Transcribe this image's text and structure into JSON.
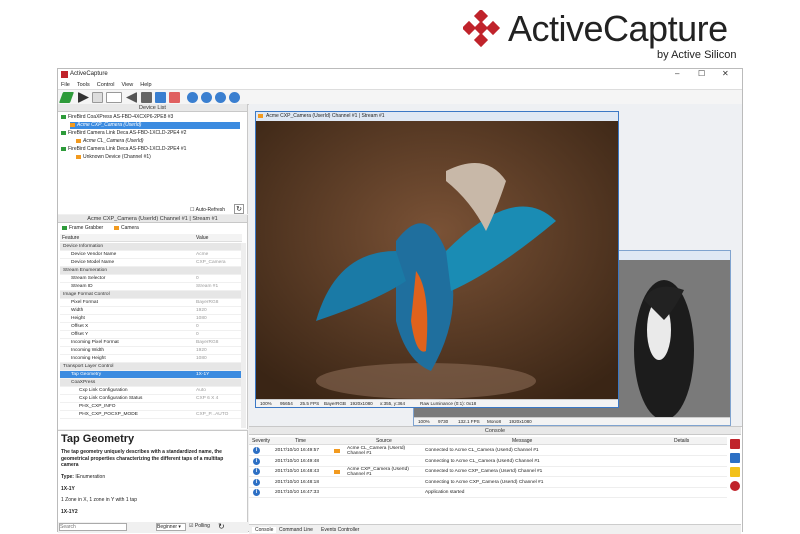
{
  "brand": {
    "name": "ActiveCapture",
    "sub": "by Active Silicon",
    "accent": "#c0232b"
  },
  "window": {
    "title": "ActiveCapture",
    "minimize": "–",
    "maximize": "☐",
    "close": "✕"
  },
  "menu": [
    "File",
    "Tools",
    "Control",
    "View",
    "Help"
  ],
  "device_list": {
    "title": "Device List",
    "items": [
      {
        "label": "FireBird CoaXPress AS-FBD-4XCXP6-2PE8 #3",
        "level": 0,
        "color": "green"
      },
      {
        "label": "Acme CXP_Camera (UserId)",
        "level": 2,
        "color": "orange",
        "selected": true
      },
      {
        "label": "FireBird Camera Link Deca AS-FBD-1XCLD-2PE4 #2",
        "level": 0,
        "color": "green"
      },
      {
        "label": "Acme CL_Camera (UserId)",
        "level": 2,
        "color": "orange"
      },
      {
        "label": "FireBird Camera Link Deca AS-FBD-1XCLD-2PE4 #1",
        "level": 0,
        "color": "green"
      },
      {
        "label": "Unknown Device (Channel #1)",
        "level": 2,
        "color": "orange"
      }
    ],
    "auto_refresh": "Auto-Refresh"
  },
  "properties": {
    "title": "Acme CXP_Camera (UserId) Channel #1 | Stream #1",
    "tabs": [
      "Frame Grabber",
      "Camera"
    ],
    "col_feature": "Feature",
    "col_value": "Value",
    "rows": [
      {
        "k": "Device Information",
        "v": "",
        "cat": true,
        "lvl": 0
      },
      {
        "k": "Device Vendor Name",
        "v": "Acme",
        "lvl": 1
      },
      {
        "k": "Device Model Name",
        "v": "CXP_Camera",
        "lvl": 1
      },
      {
        "k": "Stream Enumeration",
        "v": "",
        "cat": true,
        "lvl": 0
      },
      {
        "k": "Stream Selector",
        "v": "0",
        "lvl": 1
      },
      {
        "k": "Stream ID",
        "v": "Stream #1",
        "lvl": 1
      },
      {
        "k": "Image Format Control",
        "v": "",
        "cat": true,
        "lvl": 0
      },
      {
        "k": "Pixel Format",
        "v": "BayerRG8",
        "lvl": 1
      },
      {
        "k": "Width",
        "v": "1920",
        "lvl": 1
      },
      {
        "k": "Height",
        "v": "1080",
        "lvl": 1
      },
      {
        "k": "Offset X",
        "v": "0",
        "lvl": 1
      },
      {
        "k": "Offset Y",
        "v": "0",
        "lvl": 1
      },
      {
        "k": "Incoming Pixel Format",
        "v": "BayerRG8",
        "lvl": 1
      },
      {
        "k": "Incoming Width",
        "v": "1920",
        "lvl": 1
      },
      {
        "k": "Incoming Height",
        "v": "1080",
        "lvl": 1
      },
      {
        "k": "Transport Layer Control",
        "v": "",
        "cat": true,
        "lvl": 0
      },
      {
        "k": "Tap Geometry",
        "v": "1X-1Y",
        "lvl": 1,
        "sel": true
      },
      {
        "k": "CoaXPress",
        "v": "",
        "cat": true,
        "lvl": 1
      },
      {
        "k": "Cxp Link Configuration",
        "v": "Auto",
        "lvl": 2
      },
      {
        "k": "Cxp Link Configuration Status",
        "v": "CXP 6 X 4",
        "lvl": 2
      },
      {
        "k": "PHX_CXP_INFO",
        "v": "",
        "lvl": 2
      },
      {
        "k": "PHX_CXP_POCXP_MODE",
        "v": "CXP_P...AUTO",
        "lvl": 2
      }
    ]
  },
  "help": {
    "title": "Tap Geometry",
    "desc": "The tap geometry uniquely describes with a standardized name, the geometrical properties characterizing the different taps of a multitap camera",
    "type_label": "Type:",
    "type_value": "IEnumeration",
    "e1": "1X-1Y",
    "e1_desc": "1 Zone in X, 1 zone in Y with 1 tap",
    "e2": "1X-1Y2"
  },
  "search": {
    "placeholder": "Search",
    "level": "Beginner",
    "polling": "Polling"
  },
  "main_window": {
    "title": "Acme CXP_Camera (UserId) Channel #1 | Stream #1",
    "status": [
      "100%",
      "95654",
      "25.5 FPS",
      "BayerRGB",
      "1920x1080",
      "x:355, y:364",
      "Raw Luminance (0:1): 0x18"
    ]
  },
  "second_window": {
    "status": [
      "100%",
      "9730",
      "132.1 FPS",
      "Mono8",
      "1920x1080"
    ]
  },
  "console": {
    "title": "Console",
    "cols": [
      "Severity",
      "Time",
      "Source",
      "Message",
      "Details"
    ],
    "rows": [
      {
        "time": "2017/10/10 16:49:57",
        "source": "Acme CL_Camera (UserId) Channel #1",
        "msg": "Connected to Acme CL_Camera (UserId) Channel #1",
        "cam": true
      },
      {
        "time": "2017/10/10 16:49:48",
        "source": "",
        "msg": "Connecting to Acme CL_Camera (UserId) Channel #1",
        "cam": false
      },
      {
        "time": "2017/10/10 16:48:43",
        "source": "Acme CXP_Camera (UserId) Channel #1",
        "msg": "Connected to Acme CXP_Camera (UserId) Channel #1",
        "cam": true
      },
      {
        "time": "2017/10/10 16:48:18",
        "source": "",
        "msg": "Connecting to Acme CXP_Camera (UserId) Channel #1",
        "cam": false
      },
      {
        "time": "2017/10/10 16:47:33",
        "source": "",
        "msg": "Application started",
        "cam": false
      }
    ],
    "tabs": [
      "Console",
      "Command Line",
      "Events Controller"
    ]
  }
}
